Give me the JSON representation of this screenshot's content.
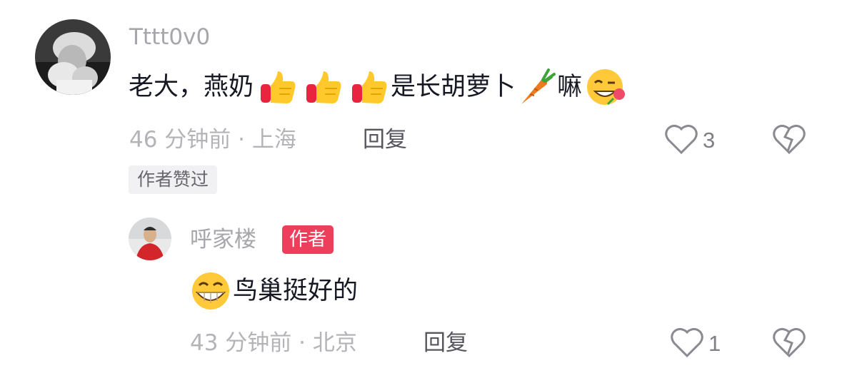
{
  "comments": [
    {
      "username": "Tttt0v0",
      "segments": [
        "老大，燕奶",
        "是长胡萝卜",
        "嘛"
      ],
      "emojis": [
        "thumbs-up",
        "thumbs-up",
        "thumbs-up",
        "carrot",
        "grin-wink-rose"
      ],
      "time_location": "46 分钟前 · 上海",
      "reply_label": "回复",
      "like_count": "3",
      "badge": "作者赞过"
    }
  ],
  "reply": {
    "username": "呼家楼",
    "author_badge": "作者",
    "emoji": "grin",
    "text": "鸟巢挺好的",
    "time_location": "43 分钟前 · 北京",
    "reply_label": "回复",
    "like_count": "1"
  },
  "colors": {
    "username": "#a6a6ab",
    "text": "#161823",
    "meta": "#b4b4b8",
    "author_badge_bg": "#ed3f5b",
    "badge_bg": "#f1f1f3"
  }
}
